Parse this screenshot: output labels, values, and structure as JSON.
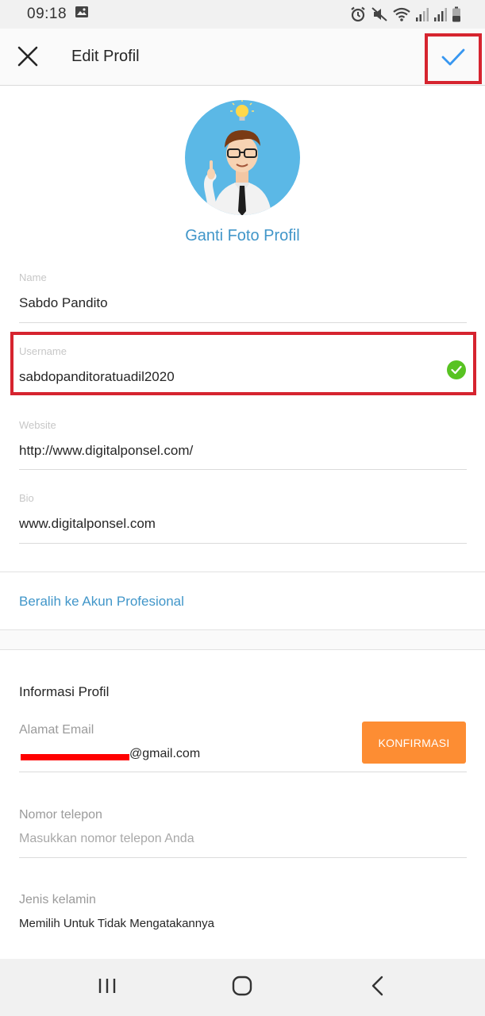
{
  "status_bar": {
    "time": "09:18"
  },
  "app_bar": {
    "title": "Edit Profil"
  },
  "profile": {
    "change_photo_label": "Ganti Foto Profil"
  },
  "fields": {
    "name": {
      "label": "Name",
      "value": "Sabdo Pandito"
    },
    "username": {
      "label": "Username",
      "value": "sabdopanditoratuadil2020",
      "status": "valid"
    },
    "website": {
      "label": "Website",
      "value": "http://www.digitalponsel.com/"
    },
    "bio": {
      "label": "Bio",
      "value": "www.digitalponsel.com"
    }
  },
  "professional_link": "Beralih ke Akun Profesional",
  "profile_info": {
    "title": "Informasi Profil",
    "email_label": "Alamat Email",
    "email_visible_part": "@gmail.com",
    "confirm_button": "KONFIRMASI",
    "phone_label": "Nomor telepon",
    "phone_placeholder": "Masukkan nomor telepon Anda",
    "gender_label": "Jenis kelamin",
    "gender_value": "Memilih Untuk Tidak Mengatakannya"
  },
  "colors": {
    "link_blue": "#4196c9",
    "highlight_red": "#d6242f",
    "confirm_orange": "#fd8d33",
    "valid_green": "#58c322"
  },
  "icons": {
    "status_left": [
      "image-icon"
    ],
    "status_right": [
      "alarm-icon",
      "mute-icon",
      "wifi-icon",
      "signal-icon",
      "signal-icon",
      "battery-icon"
    ],
    "nav": [
      "recent-apps-icon",
      "home-icon",
      "back-icon"
    ]
  }
}
